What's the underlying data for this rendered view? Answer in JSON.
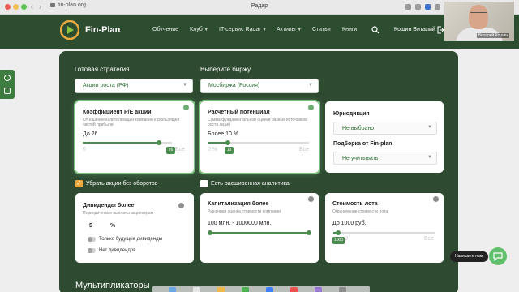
{
  "browser": {
    "address": "fin-plan.org",
    "tab_title": "Радар",
    "back": "‹",
    "forward": "›"
  },
  "header": {
    "logo_text": "Fin-Plan",
    "nav": [
      {
        "label": "Обучение",
        "dropdown": false
      },
      {
        "label": "Клуб",
        "dropdown": true
      },
      {
        "label": "IT-сервис Radar",
        "dropdown": true
      },
      {
        "label": "Активы",
        "dropdown": true
      },
      {
        "label": "Статьи",
        "dropdown": false
      },
      {
        "label": "Книги",
        "dropdown": false
      }
    ],
    "user_name": "Кошин Виталий",
    "webcam_label": "Виталий Кошин"
  },
  "colors": {
    "header_bg": "#2d4d30",
    "panel_bg": "#2e4a31",
    "accent_green": "#4a8d4e",
    "value_text": "#2e6d33",
    "checkbox_checked": "#e9a93e",
    "chat_button": "#5fbf6a"
  },
  "filters": {
    "strategy_label": "Готовая стратегия",
    "strategy_value": "Акции роста (РФ)",
    "exchange_label": "Выберите биржу",
    "exchange_value": "Мосбиржа (Россия)"
  },
  "cards": {
    "pe": {
      "title": "Коэффициент P/E акции",
      "subtitle": "Отношение капитализации компании к скользящей чистой прибыли",
      "value": "До 26",
      "min": "0",
      "max": "Все",
      "badge": "26",
      "fraction": 0.85
    },
    "potential": {
      "title": "Расчетный потенциал",
      "subtitle": "Сумма фундаментальной оценки разных источников роста акций",
      "value": "Более 10 %",
      "min": "0 %",
      "max": "Все",
      "badge": "10",
      "fraction": 0.2
    },
    "jurisdiction": {
      "label": "Юрисдикция",
      "value": "Не выбрано",
      "selection_label": "Подборка от Fin-plan",
      "selection_value": "Не учитывать"
    },
    "dividends": {
      "title": "Дивиденды более",
      "subtitle": "Периодические выплаты акционерам",
      "unit_currency": "$",
      "unit_percent": "%",
      "toggle1": "Только будущие дивиденды",
      "toggle2": "Нет дивидендов"
    },
    "capitalization": {
      "title": "Капитализация более",
      "subtitle": "Рыночная оценка стоимости компании",
      "value": "100 млн. - 1000000 млн."
    },
    "lot": {
      "title": "Стоимость лота",
      "subtitle": "Ограничение стоимости лота",
      "value": "До 1000 руб.",
      "min": "0",
      "max": "Все",
      "badge": "1000",
      "fraction": 0.05
    }
  },
  "checks": {
    "remove_no_turnover": "Убрать акции без оборотов",
    "extended_analytics": "Есть расширенная аналитика"
  },
  "section_heading": "Мультипликаторы",
  "chat": {
    "bubble": "Напишите нам!"
  }
}
